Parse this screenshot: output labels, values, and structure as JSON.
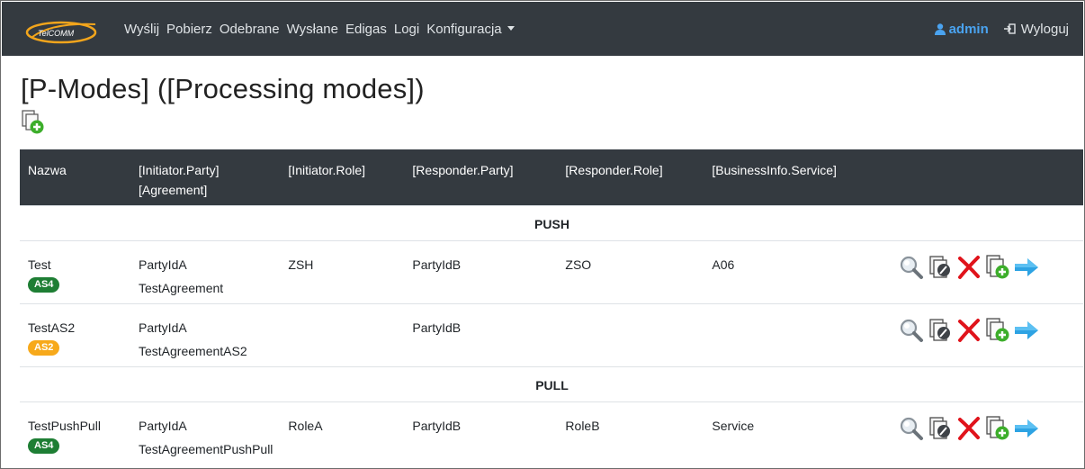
{
  "nav": {
    "brand": "TelCOMM",
    "links": [
      "Wyślij",
      "Pobierz",
      "Odebrane",
      "Wysłane",
      "Edigas",
      "Logi",
      "Konfiguracja"
    ],
    "user": "admin",
    "logout": "Wyloguj"
  },
  "page": {
    "title": "[P-Modes] ([Processing modes])"
  },
  "table": {
    "headers": {
      "name": "Nazwa",
      "initiator_party": "[Initiator.Party]",
      "agreement": "[Agreement]",
      "initiator_role": "[Initiator.Role]",
      "responder_party": "[Responder.Party]",
      "responder_role": "[Responder.Role]",
      "service": "[BusinessInfo.Service]"
    },
    "groups": [
      {
        "label": "PUSH",
        "rows": [
          {
            "name": "Test",
            "badge": "AS4",
            "initiator_party": "PartyIdA",
            "agreement": "TestAgreement",
            "initiator_role": "ZSH",
            "responder_party": "PartyIdB",
            "responder_role": "ZSO",
            "service": "A06"
          },
          {
            "name": "TestAS2",
            "badge": "AS2",
            "initiator_party": "PartyIdA",
            "agreement": "TestAgreementAS2",
            "initiator_role": "",
            "responder_party": "PartyIdB",
            "responder_role": "",
            "service": ""
          }
        ]
      },
      {
        "label": "PULL",
        "rows": [
          {
            "name": "TestPushPull",
            "badge": "AS4",
            "initiator_party": "PartyIdA",
            "agreement": "TestAgreementPushPull",
            "initiator_role": "RoleA",
            "responder_party": "PartyIdB",
            "responder_role": "RoleB",
            "service": "Service"
          }
        ]
      }
    ],
    "row_actions": [
      "view-icon",
      "edit-icon",
      "delete-icon",
      "copy-add-icon",
      "arrow-right-icon"
    ]
  },
  "colors": {
    "navbar": "#343a40",
    "admin": "#4aa3f0",
    "badge_as4": "#1e7e34",
    "badge_as2": "#f7a91b"
  }
}
